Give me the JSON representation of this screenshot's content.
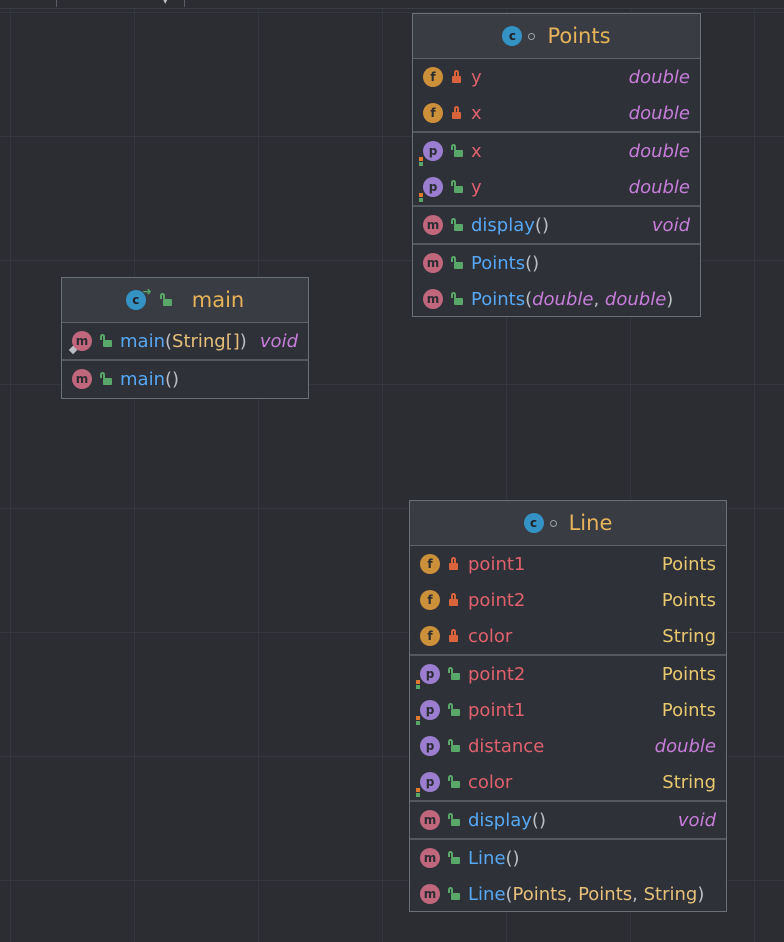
{
  "classes": {
    "points": {
      "name": "Points",
      "kind_icon": "c",
      "fields": [
        {
          "icon": "f",
          "name": "y",
          "type": "double"
        },
        {
          "icon": "f",
          "name": "x",
          "type": "double"
        }
      ],
      "properties": [
        {
          "icon": "p",
          "name": "x",
          "type": "double"
        },
        {
          "icon": "p",
          "name": "y",
          "type": "double"
        }
      ],
      "methods": [
        {
          "icon": "m",
          "name": "display",
          "params": "()",
          "type": "void"
        }
      ],
      "constructors": [
        {
          "icon": "m",
          "name": "Points",
          "open": "(",
          "p1": "",
          "sep1": "",
          "p2": "",
          "close": ")"
        },
        {
          "icon": "m",
          "name": "Points",
          "open": "(",
          "p1": "double",
          "sep1": ", ",
          "p2": "double",
          "close": ")"
        }
      ]
    },
    "main": {
      "name": "main",
      "kind_icon": "c",
      "methods": [
        {
          "icon": "m",
          "name": "main",
          "open": "(",
          "param": "String[]",
          "close": ")",
          "type": "void"
        }
      ],
      "constructors": [
        {
          "icon": "m",
          "name": "main",
          "params": "()"
        }
      ]
    },
    "line": {
      "name": "Line",
      "kind_icon": "c",
      "fields": [
        {
          "icon": "f",
          "name": "point1",
          "type": "Points"
        },
        {
          "icon": "f",
          "name": "point2",
          "type": "Points"
        },
        {
          "icon": "f",
          "name": "color",
          "type": "String"
        }
      ],
      "properties": [
        {
          "icon": "p",
          "name": "point2",
          "type": "Points"
        },
        {
          "icon": "p",
          "name": "point1",
          "type": "Points"
        },
        {
          "icon": "p",
          "name": "distance",
          "type": "double"
        },
        {
          "icon": "p",
          "name": "color",
          "type": "String"
        }
      ],
      "methods": [
        {
          "icon": "m",
          "name": "display",
          "params": "()",
          "type": "void"
        }
      ],
      "constructors": [
        {
          "icon": "m",
          "name": "Line",
          "params": "()"
        },
        {
          "icon": "m",
          "name": "Line",
          "open": "(",
          "p1": "Points",
          "sep1": ", ",
          "p2": "Points",
          "sep2": ", ",
          "p3": "String",
          "close": ")"
        }
      ]
    }
  },
  "colors": {
    "background": "#2b2d32",
    "class_title": "#e6b35a",
    "field_name": "#e0616e",
    "method_name": "#56a8f5",
    "primitive_type": "#c77dda",
    "class_type": "#e8c86e"
  }
}
